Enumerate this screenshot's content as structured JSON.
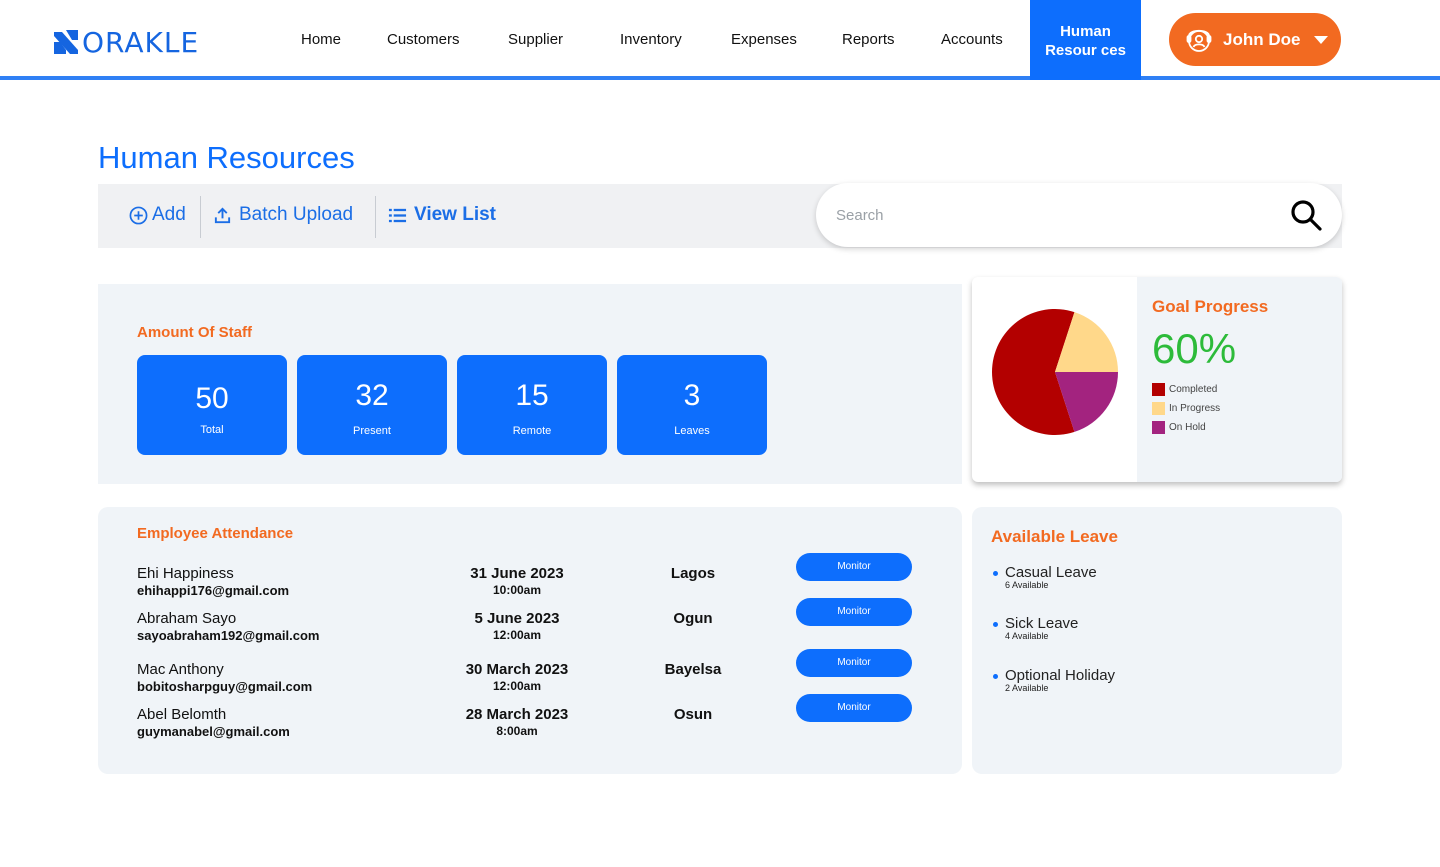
{
  "brand": {
    "logo_text": "ORAKLE",
    "accent": "#0d6efd",
    "orange": "#f26a21"
  },
  "nav": {
    "items": [
      "Home",
      "Customers",
      "Supplier",
      "Inventory",
      "Expenses",
      "Reports",
      "Accounts"
    ],
    "active_line1": "Human",
    "active_line2": "Resour ces"
  },
  "user": {
    "name": "John Doe",
    "icon": "user-support-icon"
  },
  "page": {
    "title": "Human Resources"
  },
  "toolbar": {
    "add_label": "Add",
    "batch_label": "Batch Upload",
    "view_label": "View List",
    "search_placeholder": "Search"
  },
  "staff": {
    "label": "Amount Of Staff",
    "stats": [
      {
        "value": "50",
        "label": "Total"
      },
      {
        "value": "32",
        "label": "Present"
      },
      {
        "value": "15",
        "label": "Remote"
      },
      {
        "value": "3",
        "label": "Leaves"
      }
    ]
  },
  "goal": {
    "title": "Goal Progress",
    "value": "60%",
    "legend": [
      {
        "label": "Completed",
        "color": "#b30000"
      },
      {
        "label": "In Progress",
        "color": "#ffd88a"
      },
      {
        "label": "On Hold",
        "color": "#a3237f"
      }
    ]
  },
  "chart_data": {
    "type": "pie",
    "categories": [
      "Completed",
      "In Progress",
      "On Hold"
    ],
    "values": [
      60,
      20,
      20
    ],
    "colors": [
      "#b30000",
      "#ffd88a",
      "#a3237f"
    ]
  },
  "attendance": {
    "title": "Employee Attendance",
    "monitor_label": "Monitor",
    "rows": [
      {
        "name": "Ehi Happiness",
        "email": "ehihappi176@gmail.com",
        "date": "31 June 2023",
        "time": "10:00am",
        "location": "Lagos"
      },
      {
        "name": "Abraham Sayo",
        "email": "sayoabraham192@gmail.com",
        "date": "5 June 2023",
        "time": "12:00am",
        "location": "Ogun"
      },
      {
        "name": "Mac Anthony",
        "email": "bobitosharpguy@gmail.com",
        "date": "30 March 2023",
        "time": "12:00am",
        "location": "Bayelsa"
      },
      {
        "name": "Abel Belomth",
        "email": "guymanabel@gmail.com",
        "date": "28 March 2023",
        "time": "8:00am",
        "location": "Osun"
      }
    ]
  },
  "leave": {
    "title": "Available Leave",
    "items": [
      {
        "name": "Casual Leave",
        "available": "6 Available"
      },
      {
        "name": "Sick Leave",
        "available": "4 Available"
      },
      {
        "name": "Optional Holiday",
        "available": "2 Available"
      }
    ]
  }
}
